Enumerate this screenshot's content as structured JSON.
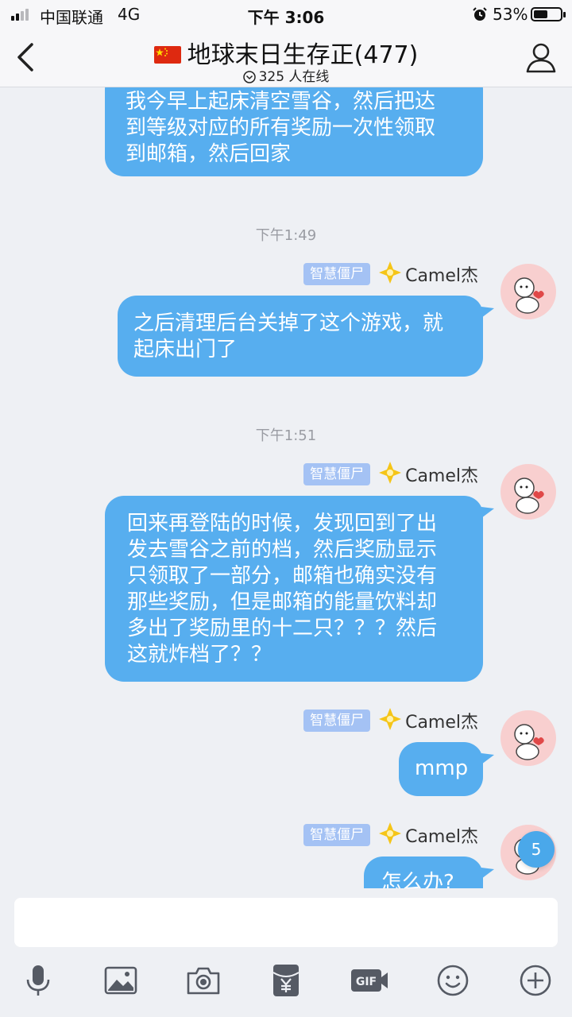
{
  "status_bar": {
    "carrier": "中国联通",
    "network": "4G",
    "time": "下午 3:06",
    "battery_percent": "53%",
    "battery_level": 0.53,
    "signal_bars": 2
  },
  "header": {
    "flag_icon": "china-flag-icon",
    "title": "地球末日生存正(477)",
    "online_count": "325 人在线",
    "back_icon": "chevron-left-icon",
    "members_icon": "person-icon"
  },
  "messages": {
    "m1": {
      "lines": [
        "我今早上起床清空雪谷，然后把达",
        "到等级对应的所有奖励一次性领取",
        "到邮箱，然后回家"
      ]
    },
    "t1": "下午1:49",
    "m2": {
      "badge": "智慧僵尸",
      "sender": "Camel杰",
      "lines": [
        "之后清理后台关掉了这个游戏，就",
        "起床出门了"
      ]
    },
    "t2": "下午1:51",
    "m3": {
      "badge": "智慧僵尸",
      "sender": "Camel杰",
      "lines": [
        "回来再登陆的时候，发现回到了出",
        "发去雪谷之前的档，然后奖励显示",
        "只领取了一部分，邮箱也确实没有",
        "那些奖励，但是邮箱的能量饮料却",
        "多出了奖励里的十二只？？？然后",
        "这就炸档了？？"
      ]
    },
    "m4": {
      "badge": "智慧僵尸",
      "sender": "Camel杰",
      "lines": [
        "mmp"
      ]
    },
    "m5": {
      "badge": "智慧僵尸",
      "sender": "Camel杰",
      "lines": [
        "怎么办?"
      ]
    }
  },
  "unread_count": "5",
  "input": {
    "value": ""
  },
  "toolbar": [
    "microphone-icon",
    "image-icon",
    "camera-icon",
    "red-packet-icon",
    "gif-icon",
    "emoji-icon",
    "plus-icon"
  ],
  "colors": {
    "bubble": "#57aeef",
    "badge": "#a4c2f4",
    "avatar_bg": "#f8cfcf"
  }
}
